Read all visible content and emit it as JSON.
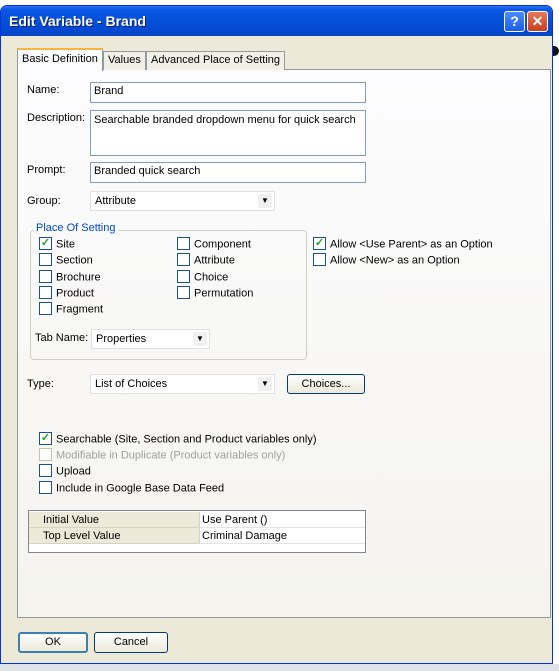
{
  "window": {
    "title": "Edit Variable - Brand",
    "help_glyph": "?",
    "close_glyph": "✕"
  },
  "tabs": [
    "Basic Definition",
    "Values",
    "Advanced Place of Setting"
  ],
  "form": {
    "name_label": "Name:",
    "name_value": "Brand",
    "description_label": "Description:",
    "description_value": "Searchable branded dropdown menu for quick search",
    "prompt_label": "Prompt:",
    "prompt_value": "Branded quick search",
    "group_label": "Group:",
    "group_value": "Attribute"
  },
  "place_of_setting": {
    "title": "Place Of Setting",
    "items": [
      {
        "label": "Site",
        "checked": true
      },
      {
        "label": "Section",
        "checked": false
      },
      {
        "label": "Brochure",
        "checked": false
      },
      {
        "label": "Product",
        "checked": false
      },
      {
        "label": "Fragment",
        "checked": false
      },
      {
        "label": "Component",
        "checked": false
      },
      {
        "label": "Attribute",
        "checked": false
      },
      {
        "label": "Choice",
        "checked": false
      },
      {
        "label": "Permutation",
        "checked": false
      }
    ],
    "tab_name_label": "Tab Name:",
    "tab_name_value": "Properties"
  },
  "allow_options": [
    {
      "label": "Allow <Use Parent> as an Option",
      "checked": true
    },
    {
      "label": "Allow <New> as an Option",
      "checked": false
    }
  ],
  "type": {
    "label": "Type:",
    "value": "List of Choices",
    "choices_button": "Choices..."
  },
  "options": [
    {
      "label": "Searchable (Site, Section and Product variables only)",
      "checked": true,
      "disabled": false
    },
    {
      "label": "Modifiable in Duplicate (Product variables only)",
      "checked": false,
      "disabled": true
    },
    {
      "label": "Upload",
      "checked": false,
      "disabled": false
    },
    {
      "label": "Include in Google Base Data Feed",
      "checked": false,
      "disabled": false
    }
  ],
  "values_grid": [
    {
      "name": "Initial Value",
      "value": "Use Parent ()"
    },
    {
      "name": "Top Level Value",
      "value": "Criminal Damage"
    }
  ],
  "buttons": {
    "ok": "OK",
    "cancel": "Cancel"
  },
  "check_glyph": "✓",
  "dropdown_glyph": "▼"
}
